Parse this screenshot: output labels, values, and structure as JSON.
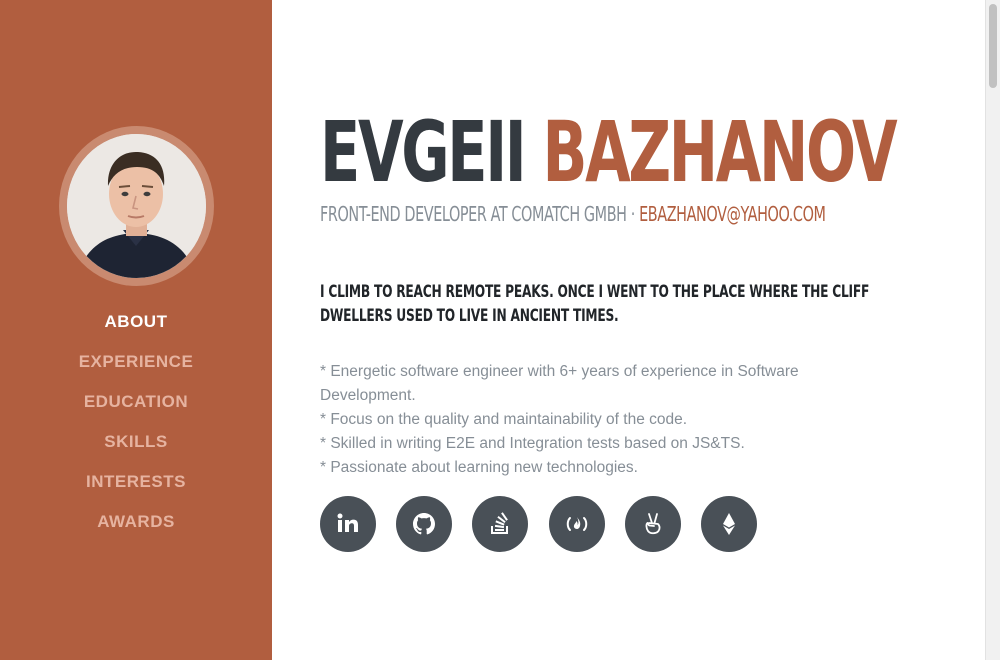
{
  "profile": {
    "first_name": "EVGEII",
    "last_name": "BAZHANOV",
    "position": "FRONT-END DEVELOPER AT COMATCH GMBH",
    "separator": " · ",
    "email": "EBAZHANOV@YAHOO.COM"
  },
  "nav": {
    "items": [
      {
        "label": "ABOUT",
        "active": true
      },
      {
        "label": "EXPERIENCE"
      },
      {
        "label": "EDUCATION"
      },
      {
        "label": "SKILLS"
      },
      {
        "label": "INTERESTS"
      },
      {
        "label": "AWARDS"
      }
    ]
  },
  "about": {
    "lead": "I CLIMB TO REACH REMOTE PEAKS. ONCE I WENT TO THE PLACE WHERE THE CLIFF DWELLERS USED TO LIVE IN ANCIENT TIMES.",
    "bullets": [
      "* Energetic software engineer with 6+ years of experience in Software Development.",
      "* Focus on the quality and maintainability of the code.",
      "* Skilled in writing E2E and Integration tests based on JS&TS.",
      "* Passionate about learning new technologies."
    ]
  },
  "socials": [
    {
      "icon": "linkedin-icon"
    },
    {
      "icon": "github-icon"
    },
    {
      "icon": "stackoverflow-icon"
    },
    {
      "icon": "freecodecamp-icon"
    },
    {
      "icon": "angellist-icon"
    },
    {
      "icon": "ethereum-icon"
    }
  ],
  "colors": {
    "sidebar": "#b15e3f",
    "accent": "#b15e3f",
    "heading": "#343a40",
    "muted": "#868e96",
    "social_bg": "#495057"
  }
}
